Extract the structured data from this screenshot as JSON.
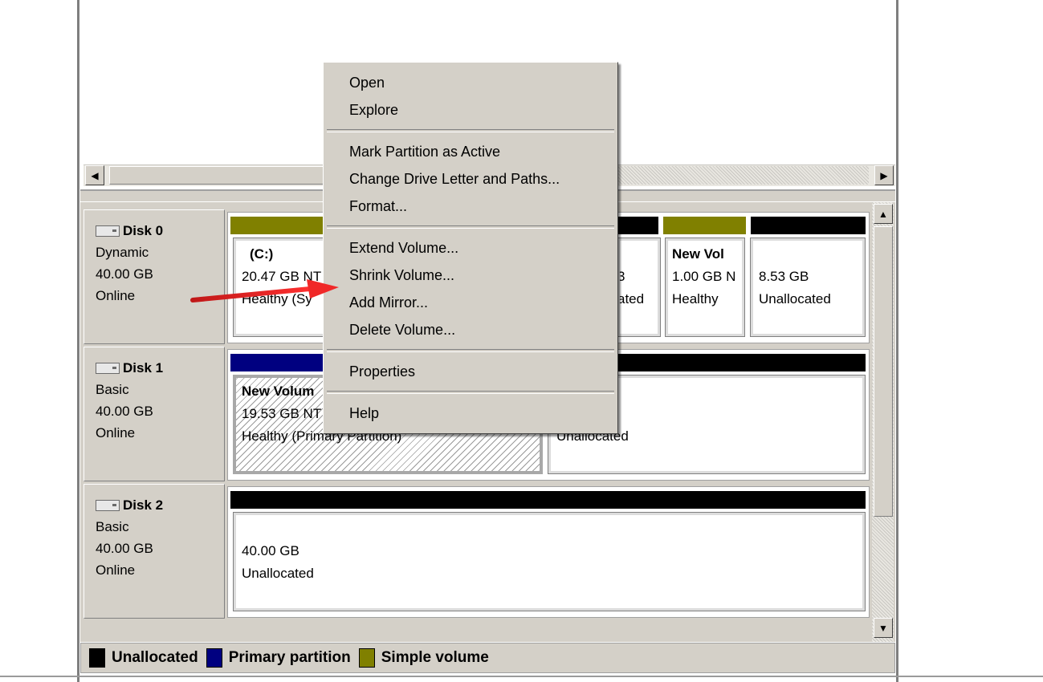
{
  "legend": [
    {
      "label": "Unallocated",
      "color": "#000000"
    },
    {
      "label": "Primary partition",
      "color": "#000080"
    },
    {
      "label": "Simple volume",
      "color": "#808000"
    }
  ],
  "disks": [
    {
      "name": "Disk 0",
      "type": "Dynamic",
      "size": "40.00 GB",
      "status": "Online",
      "volumes": [
        {
          "title": "(C:)",
          "line1": "20.47 GB NT",
          "line2": "Healthy (Sy"
        },
        {
          "title": "",
          "line1": "3",
          "line2": "ated"
        },
        {
          "title": "New Vol",
          "line1": "1.00 GB N",
          "line2": "Healthy"
        },
        {
          "title": "",
          "line1": "8.53 GB",
          "line2": "Unallocated"
        }
      ]
    },
    {
      "name": "Disk 1",
      "type": "Basic",
      "size": "40.00 GB",
      "status": "Online",
      "volumes": [
        {
          "title": "New Volum",
          "line1": "19.53 GB NT",
          "line2": "Healthy (Primary Partition)"
        },
        {
          "title": "",
          "line1": "3",
          "line2": "Unallocated"
        }
      ]
    },
    {
      "name": "Disk 2",
      "type": "Basic",
      "size": "40.00 GB",
      "status": "Online",
      "volumes": [
        {
          "title": "",
          "line1": "40.00 GB",
          "line2": "Unallocated"
        }
      ]
    }
  ],
  "context_menu": {
    "items": [
      "Open",
      "Explore",
      "Mark Partition as Active",
      "Change Drive Letter and Paths...",
      "Format...",
      "Extend Volume...",
      "Shrink Volume...",
      "Add Mirror...",
      "Delete Volume...",
      "Properties",
      "Help"
    ]
  },
  "scroll_arrows": {
    "left": "◀",
    "right": "▶",
    "up": "▲",
    "down": "▼"
  },
  "colors": {
    "unallocated": "#000000",
    "primary": "#000080",
    "simple": "#808000",
    "annotation_arrow": "#e02020"
  }
}
